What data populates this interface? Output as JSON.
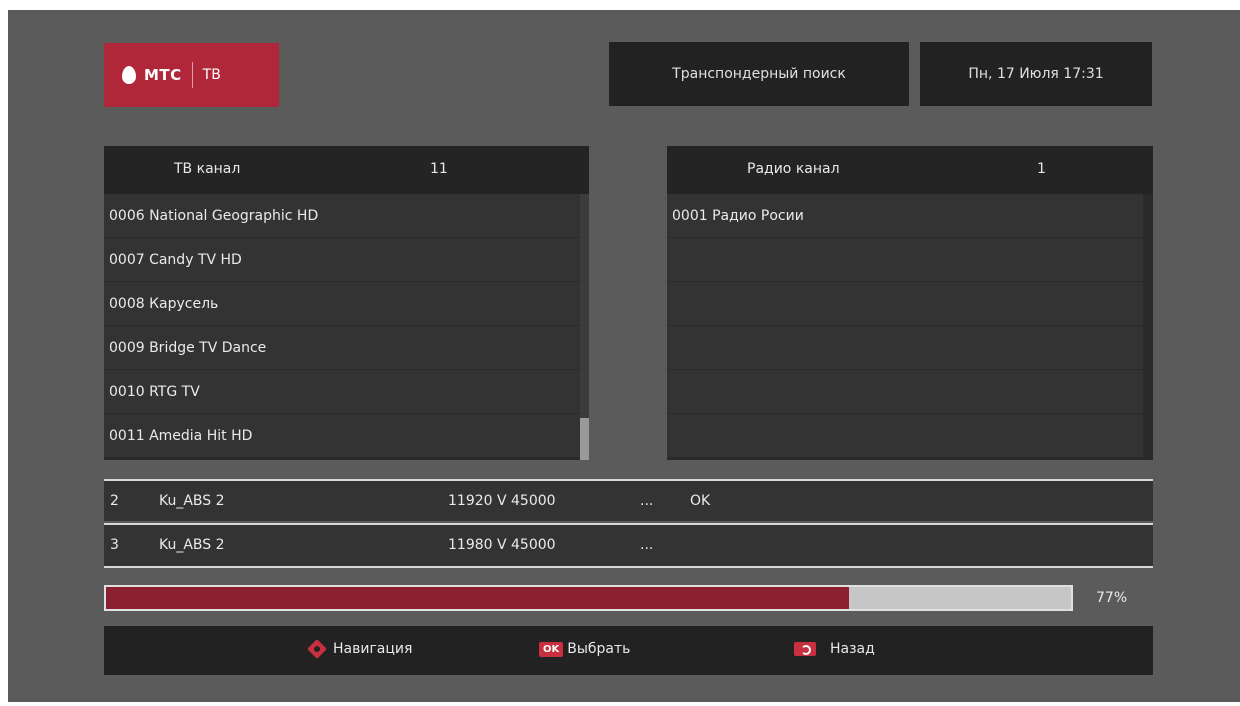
{
  "logo": {
    "brand": "МТС",
    "service": "ТВ"
  },
  "header": {
    "search_mode": "Транспондерный поиск",
    "datetime": "Пн, 17 Июля 17:31"
  },
  "tv_list": {
    "title": "ТВ канал",
    "count": "11",
    "items": [
      "0006  National Geographic HD",
      "0007  Candy TV HD",
      "0008  Карусель",
      "0009  Bridge TV Dance",
      "0010  RTG TV",
      "0011  Amedia Hit HD"
    ]
  },
  "radio_list": {
    "title": "Радио канал",
    "count": "1",
    "items": [
      "0001  Радио Росии",
      "",
      "",
      "",
      "",
      ""
    ]
  },
  "transponders": [
    {
      "num": "2",
      "name": "Ku_ABS 2",
      "freq": "11920 V 45000",
      "progress": "...",
      "status": "OK"
    },
    {
      "num": "3",
      "name": "Ku_ABS 2",
      "freq": "11980 V 45000",
      "progress": "...",
      "status": ""
    }
  ],
  "scan": {
    "progress_fraction": 0.77,
    "percent_label": "77%"
  },
  "footer": {
    "nav_label": "Навигация",
    "ok_badge": "OK",
    "ok_label": "Выбрать",
    "back_label": "Назад"
  },
  "colors": {
    "accent": "#c8303f",
    "progress": "#8b2130",
    "background": "#5b5b5b"
  },
  "icons": {
    "brand": "mts-egg-icon",
    "nav": "navigation-diamond-icon",
    "back": "back-arrow-icon"
  }
}
